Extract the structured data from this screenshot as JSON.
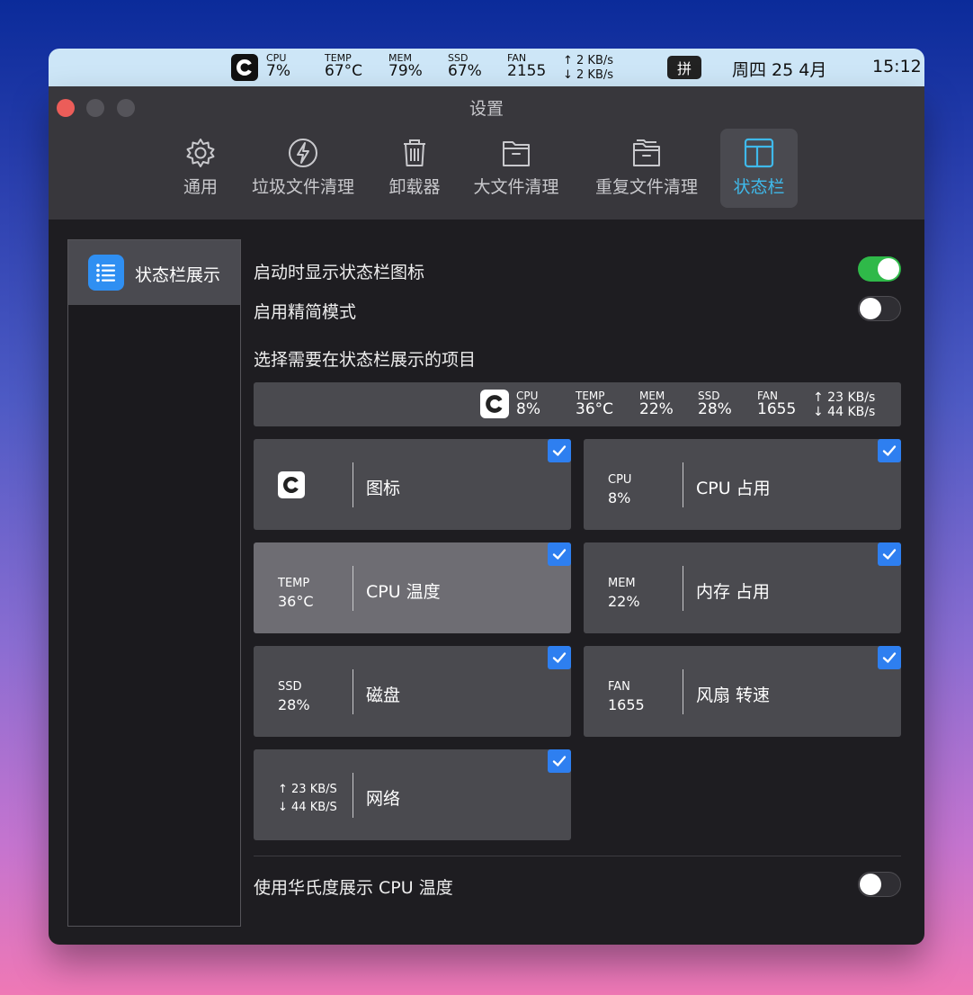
{
  "menubar": {
    "stats": [
      {
        "label": "CPU",
        "value": "7%"
      },
      {
        "label": "TEMP",
        "value": "67°C"
      },
      {
        "label": "MEM",
        "value": "79%"
      },
      {
        "label": "SSD",
        "value": "67%"
      },
      {
        "label": "FAN",
        "value": "2155"
      }
    ],
    "net_up": "↑ 2 KB/s",
    "net_down": "↓ 2 KB/s",
    "input_method": "拼",
    "date": "周四 25 4月",
    "time": "15:12"
  },
  "window": {
    "title": "设置",
    "tabs": [
      {
        "label": "通用",
        "icon": "gear-icon"
      },
      {
        "label": "垃圾文件清理",
        "icon": "lightning-icon"
      },
      {
        "label": "卸载器",
        "icon": "trash-icon"
      },
      {
        "label": "大文件清理",
        "icon": "folder-icon"
      },
      {
        "label": "重复文件清理",
        "icon": "folder-stack-icon"
      },
      {
        "label": "状态栏",
        "icon": "layout-icon",
        "active": true
      }
    ]
  },
  "sidebar": {
    "items": [
      {
        "label": "状态栏展示",
        "icon": "list-icon",
        "selected": true
      }
    ]
  },
  "settings": {
    "show_icon_on_launch": {
      "label": "启动时显示状态栏图标",
      "on": true
    },
    "compact_mode": {
      "label": "启用精简模式",
      "on": false
    },
    "choose_items_label": "选择需要在状态栏展示的项目",
    "fahrenheit": {
      "label": "使用华氏度展示 CPU 温度",
      "on": false
    }
  },
  "preview": {
    "stats": [
      {
        "label": "CPU",
        "value": "8%"
      },
      {
        "label": "TEMP",
        "value": "36°C"
      },
      {
        "label": "MEM",
        "value": "22%"
      },
      {
        "label": "SSD",
        "value": "28%"
      },
      {
        "label": "FAN",
        "value": "1655"
      }
    ],
    "net_up": "↑ 23 KB/s",
    "net_down": "↓ 44 KB/s"
  },
  "cards": [
    {
      "kind": "icon",
      "name": "图标",
      "checked": true
    },
    {
      "kind": "stat",
      "label": "CPU",
      "value": "8%",
      "name": "CPU 占用",
      "checked": true
    },
    {
      "kind": "stat",
      "label": "TEMP",
      "value": "36°C",
      "name": "CPU 温度",
      "checked": true,
      "highlighted": true
    },
    {
      "kind": "stat",
      "label": "MEM",
      "value": "22%",
      "name": "内存 占用",
      "checked": true
    },
    {
      "kind": "stat",
      "label": "SSD",
      "value": "28%",
      "name": "磁盘",
      "checked": true
    },
    {
      "kind": "stat",
      "label": "FAN",
      "value": "1655",
      "name": "风扇 转速",
      "checked": true
    },
    {
      "kind": "net",
      "up": "↑ 23 KB/S",
      "down": "↓ 44 KB/S",
      "name": "网络",
      "checked": true
    }
  ],
  "colors": {
    "accent_blue": "#2e7ff0",
    "active_tab": "#3fb9ea",
    "toggle_on": "#2fb949",
    "close": "#ec5d59"
  }
}
